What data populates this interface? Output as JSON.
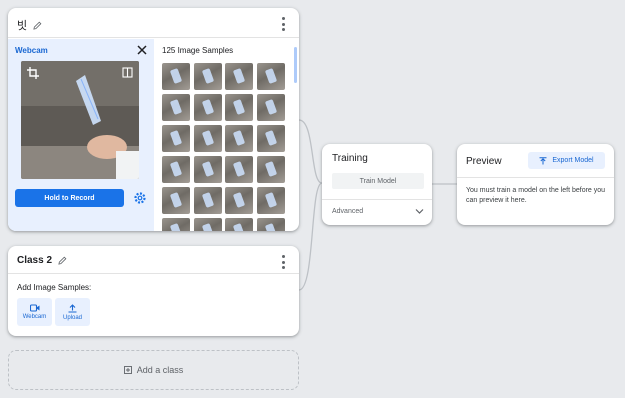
{
  "class1": {
    "name": "빗",
    "webcam_label": "Webcam",
    "record_label": "Hold to Record",
    "samples_title": "125 Image Samples",
    "thumb_count": 24
  },
  "class2": {
    "name": "Class 2",
    "add_samples_label": "Add Image Samples:",
    "webcam_label": "Webcam",
    "upload_label": "Upload"
  },
  "add_class_label": "Add a class",
  "training": {
    "title": "Training",
    "train_button": "Train Model",
    "advanced_label": "Advanced"
  },
  "preview": {
    "title": "Preview",
    "export_button": "Export Model",
    "message": "You must train a model on the left before you can preview it here."
  },
  "colors": {
    "accent": "#1a73e8",
    "accent_light": "#e8f0fe",
    "background": "#e8eaed"
  }
}
